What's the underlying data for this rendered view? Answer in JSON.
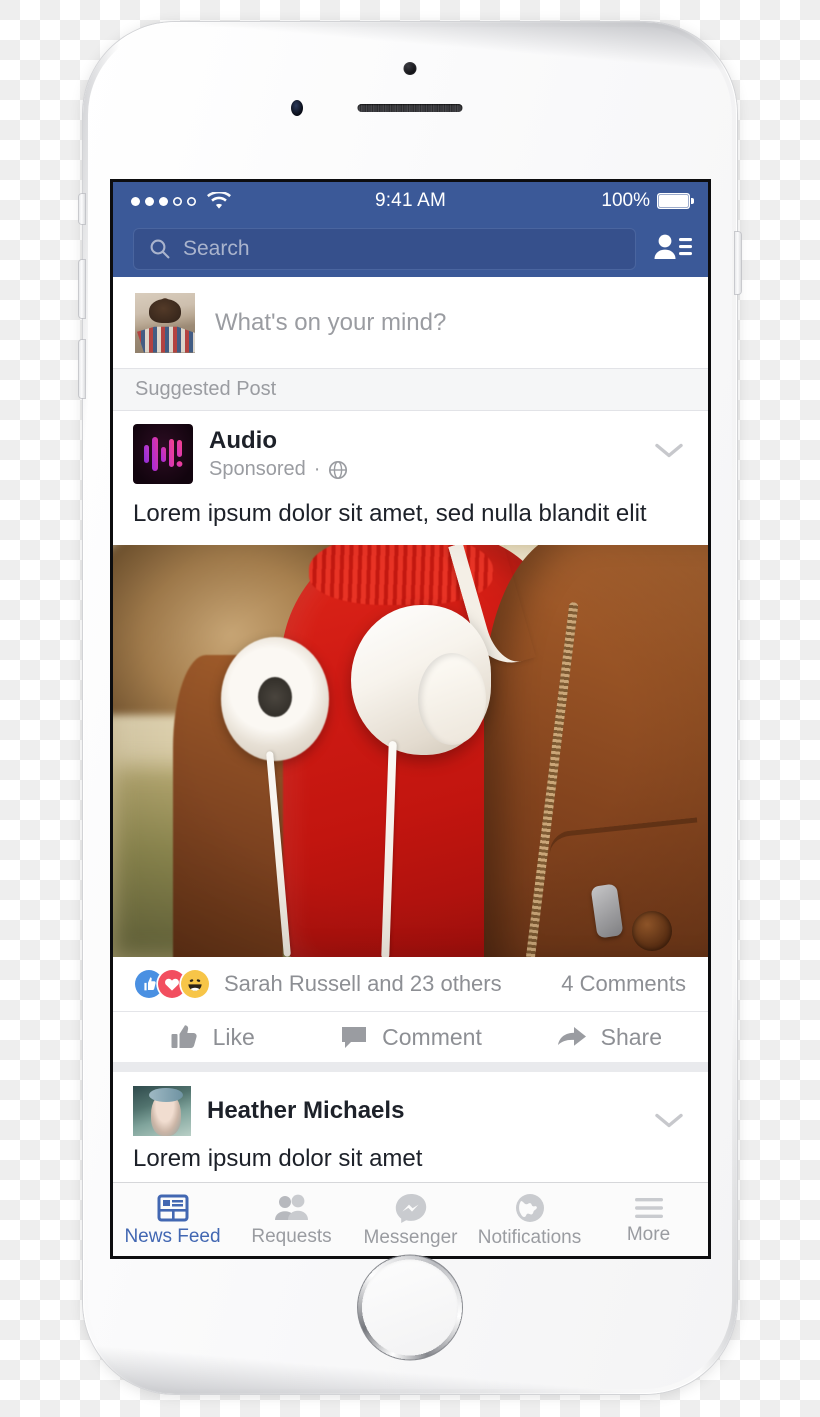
{
  "device": {
    "name": "iPhone 6 silver",
    "hardware": {
      "silent_switch": "ring-silent-switch",
      "volume_up": "volume-up-button",
      "volume_down": "volume-down-button",
      "power": "power-button",
      "home": "home-button"
    }
  },
  "status_bar": {
    "carrier_signal_filled": 3,
    "carrier_signal_total": 5,
    "wifi": "wifi-icon",
    "time": "9:41 AM",
    "battery_percent": "100%",
    "battery_level": 100
  },
  "nav": {
    "search_placeholder": "Search",
    "search_value": "",
    "requests_icon": "friend-requests-icon",
    "bar_color": "#3b5998",
    "field_color": "#36508c"
  },
  "composer": {
    "placeholder": "What's on your mind?",
    "avatar": "user-profile-photo"
  },
  "feed": {
    "suggested_label": "Suggested Post",
    "post": {
      "page_name": "Audio",
      "sponsored_label": "Sponsored",
      "separator": "·",
      "privacy_icon": "globe-icon",
      "menu_icon": "chevron-down-icon",
      "logo": "audio-waveform-logo",
      "message": "Lorem ipsum dolor sit amet, sed nulla blandit elit",
      "photo_alt": "woman-with-white-headphones-photo",
      "reactions": {
        "icons": [
          "like-reaction",
          "love-reaction",
          "haha-reaction"
        ],
        "colors": [
          "#4a90e2",
          "#f24e5f",
          "#f7c548"
        ],
        "names_text": "Sarah Russell and 23 others",
        "comments_text": "4 Comments"
      },
      "actions": [
        {
          "label": "Like",
          "icon": "thumbs-up-icon"
        },
        {
          "label": "Comment",
          "icon": "comment-bubble-icon"
        },
        {
          "label": "Share",
          "icon": "share-arrow-icon"
        }
      ]
    },
    "post2": {
      "author": "Heather Michaels",
      "teaser": "Lorem ipsum dolor sit amet",
      "avatar": "heather-michaels-photo",
      "menu_icon": "chevron-down-icon"
    }
  },
  "tab_bar": {
    "active_color": "#4267b2",
    "inactive_color": "#9a9ca1",
    "tabs": [
      {
        "label": "News Feed",
        "icon": "news-feed-icon",
        "active": true
      },
      {
        "label": "Requests",
        "icon": "friends-icon",
        "active": false
      },
      {
        "label": "Messenger",
        "icon": "messenger-icon",
        "active": false
      },
      {
        "label": "Notifications",
        "icon": "globe-notifications-icon",
        "active": false
      },
      {
        "label": "More",
        "icon": "hamburger-menu-icon",
        "active": false
      }
    ]
  }
}
